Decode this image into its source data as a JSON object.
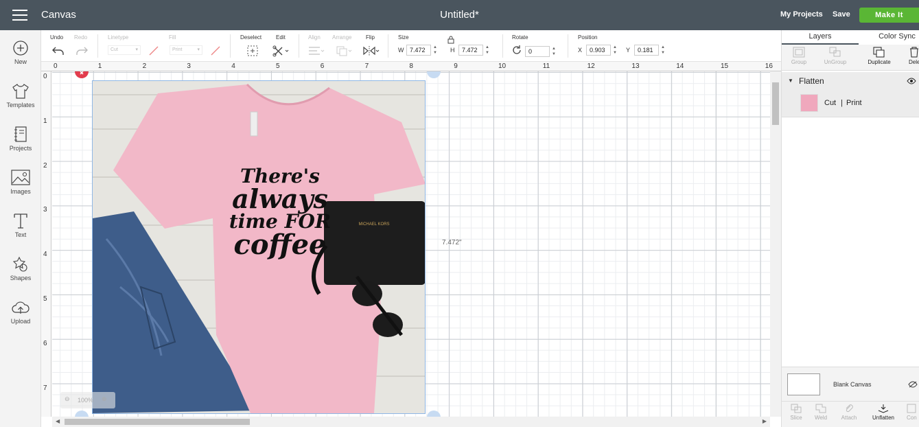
{
  "topbar": {
    "app_title": "Canvas",
    "doc_title": "Untitled*",
    "my_projects": "My Projects",
    "save": "Save",
    "make_it": "Make It"
  },
  "sidebar": {
    "items": [
      {
        "label": "New",
        "icon": "plus-circle-icon"
      },
      {
        "label": "Templates",
        "icon": "tshirt-icon"
      },
      {
        "label": "Projects",
        "icon": "notebook-icon"
      },
      {
        "label": "Images",
        "icon": "image-icon"
      },
      {
        "label": "Text",
        "icon": "text-icon"
      },
      {
        "label": "Shapes",
        "icon": "shapes-icon"
      },
      {
        "label": "Upload",
        "icon": "upload-cloud-icon"
      }
    ]
  },
  "toolbar": {
    "undo": "Undo",
    "redo": "Redo",
    "linetype": "Linetype",
    "linetype_value": "Cut",
    "fill": "Fill",
    "fill_value": "Print",
    "deselect": "Deselect",
    "edit": "Edit",
    "align": "Align",
    "arrange": "Arrange",
    "flip": "Flip",
    "size": "Size",
    "w_label": "W",
    "w_value": "7.472",
    "h_label": "H",
    "h_value": "7.472",
    "rotate": "Rotate",
    "rotate_value": "0",
    "position": "Position",
    "x_label": "X",
    "x_value": "0.903",
    "y_label": "Y",
    "y_value": "0.181"
  },
  "ruler": {
    "top": [
      "0",
      "1",
      "2",
      "3",
      "4",
      "5",
      "6",
      "7",
      "8",
      "9",
      "10",
      "11",
      "12",
      "13",
      "14",
      "15",
      "16"
    ],
    "left": [
      "0",
      "1",
      "2",
      "3",
      "4",
      "5",
      "6",
      "7"
    ]
  },
  "canvas": {
    "dimension_label": "7.472\"",
    "zoom": "100%",
    "shirt_text": [
      "There's",
      "always",
      "time FOR",
      "coffee"
    ]
  },
  "panel": {
    "tab_layers": "Layers",
    "tab_color_sync": "Color Sync",
    "group": "Group",
    "ungroup": "UnGroup",
    "duplicate": "Duplicate",
    "delete": "Dele",
    "layer_group_name": "Flatten",
    "layer_cut": "Cut",
    "layer_sep": "|",
    "layer_print": "Print",
    "blank_canvas": "Blank Canvas",
    "slice": "Slice",
    "weld": "Weld",
    "attach": "Attach",
    "unflatten": "Unflatten",
    "contour": "Con"
  },
  "colors": {
    "topbar": "#4a555e",
    "make_it": "#5ab635",
    "shirt": "#f2b8c8",
    "selection": "#8fb7e5"
  }
}
